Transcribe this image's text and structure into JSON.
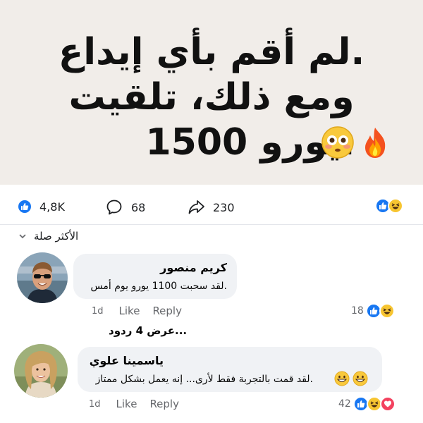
{
  "post": {
    "headline_line1": ".لم أقم بأي إيداع",
    "headline_line2": "ومع ذلك، تلقيت",
    "headline_line3": ".يورو 1500",
    "headline_emojis": [
      "flushed-face",
      "fire"
    ]
  },
  "stats": {
    "likes": "4,8K",
    "comments": "68",
    "shares": "230",
    "reactions": [
      "like",
      "haha"
    ]
  },
  "sort": {
    "label": "الأكثر صلة"
  },
  "comments": [
    {
      "name": "كريم منصور",
      "text": ".لقد سحبت 1100 يورو يوم أمس",
      "time": "1d",
      "like_label": "Like",
      "reply_label": "Reply",
      "reaction_count": "18",
      "reactions": [
        "like",
        "haha"
      ]
    },
    {
      "name": "ياسمينا علوي",
      "text": ".لقد قمت بالتجربة فقط لأرى... إنه يعمل بشكل ممتاز",
      "emojis": [
        "grinning-face",
        "grinning-face"
      ],
      "time": "1d",
      "like_label": "Like",
      "reply_label": "Reply",
      "reaction_count": "42",
      "reactions": [
        "like",
        "haha",
        "love"
      ]
    }
  ],
  "replies_link": "...عرض 4 ردود",
  "colors": {
    "facebook_blue": "#1877f2",
    "haha_yellow": "#f7c531",
    "love_red": "#f3425f",
    "hero_bg": "#f1ede9",
    "bubble_bg": "#f0f2f5"
  }
}
